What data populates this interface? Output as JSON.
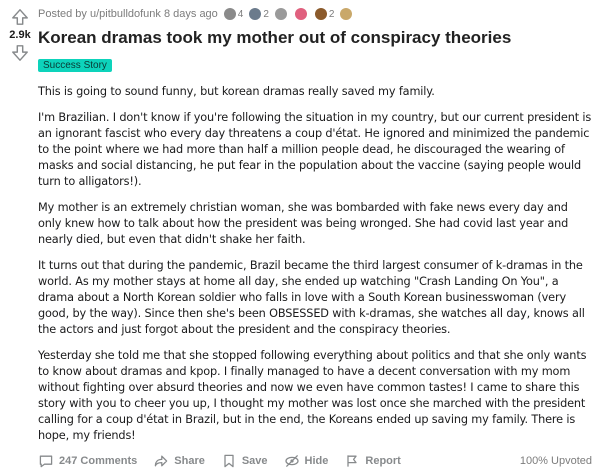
{
  "vote": {
    "score": "2.9k"
  },
  "post": {
    "meta_text": "Posted by u/pitbulldofunk 8 days ago",
    "awards": [
      {
        "icon": "award-silver-icon",
        "count": "4",
        "color": "#8a8a8a"
      },
      {
        "icon": "award-helpful-icon",
        "count": "2",
        "color": "#6b7b8c"
      },
      {
        "icon": "award-wholesome-icon",
        "count": "",
        "color": "#9a9a9a"
      },
      {
        "icon": "award-heart-icon",
        "count": "",
        "color": "#e0607e"
      },
      {
        "icon": "award-bear-icon",
        "count": "2",
        "color": "#8b5a2b"
      }
    ],
    "award_more": "",
    "title": "Korean dramas took my mother out of conspiracy theories",
    "flair": "Success Story",
    "paragraphs": [
      "This is going to sound funny, but korean dramas really saved my family.",
      "I'm Brazilian. I don't know if you're following the situation in my country, but our current president is an ignorant fascist who every day threatens a coup d'état. He ignored and minimized the pandemic to the point where we had more than half a million people dead, he discouraged the wearing of masks and social distancing, he put fear in the population about the vaccine (saying people would turn to alligators!).",
      "My mother is an extremely christian woman, she was bombarded with fake news every day and only knew how to talk about how the president was being wronged. She had covid last year and nearly died, but even that didn't shake her faith.",
      "It turns out that during the pandemic, Brazil became the third largest consumer of k-dramas in the world. As my mother stays at home all day, she ended up watching \"Crash Landing On You\", a drama about a North Korean soldier who falls in love with a South Korean businesswoman (very good, by the way). Since then she's been OBSESSED with k-dramas, she watches all day, knows all the actors and just forgot about the president and the conspiracy theories.",
      "Yesterday she told me that she stopped following everything about politics and that she only wants to know about dramas and kpop. I finally managed to have a decent conversation with my mom without fighting over absurd theories and now we even have common tastes! I came to share this story with you to cheer you up, I thought my mother was lost once she marched with the president calling for a coup d'état in Brazil, but in the end, the Koreans ended up saving my family. There is hope, my friends!"
    ]
  },
  "actions": {
    "comments": "247 Comments",
    "share": "Share",
    "save": "Save",
    "hide": "Hide",
    "report": "Report",
    "upvoted": "100% Upvoted"
  }
}
